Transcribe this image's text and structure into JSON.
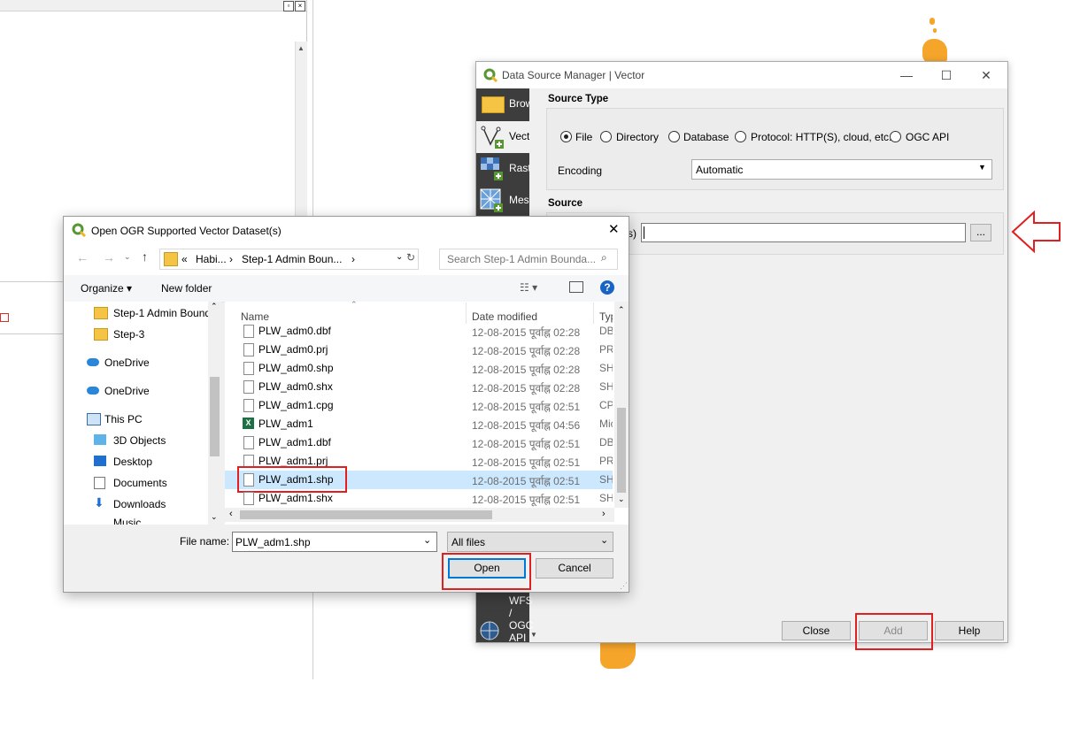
{
  "dsm": {
    "title": "Data Source Manager | Vector",
    "sidebar": [
      "Browser",
      "Vector",
      "Raster",
      "Mesh"
    ],
    "sidebar_bottom": [
      "WFS",
      "/",
      "OGC",
      "API"
    ],
    "source_type_label": "Source Type",
    "radio_options": [
      "File",
      "Directory",
      "Database",
      "Protocol: HTTP(S), cloud, etc.",
      "OGC API"
    ],
    "encoding_label": "Encoding",
    "encoding_value": "Automatic",
    "source_label": "Source",
    "source_field_label_fragment": "(s)",
    "browse_label": "...",
    "buttons": {
      "close": "Close",
      "add": "Add",
      "help": "Help"
    }
  },
  "dialog": {
    "title": "Open OGR Supported Vector Dataset(s)",
    "breadcrumb": [
      "«",
      "Habi...",
      "›",
      "Step-1 Admin Boun...",
      "›"
    ],
    "search_placeholder": "Search Step-1 Admin Bounda...",
    "organize": "Organize ▾",
    "new_folder": "New folder",
    "nav_items": [
      {
        "label": "Step-1 Admin Bound",
        "icon": "folder-icon"
      },
      {
        "label": "Step-3",
        "icon": "folder-icon"
      },
      {
        "label": "OneDrive",
        "icon": "onedrive-icon"
      },
      {
        "label": "OneDrive",
        "icon": "onedrive-icon"
      },
      {
        "label": "This PC",
        "icon": "pc-icon"
      },
      {
        "label": "3D Objects",
        "icon": "cube-icon"
      },
      {
        "label": "Desktop",
        "icon": "desktop-icon"
      },
      {
        "label": "Documents",
        "icon": "documents-icon"
      },
      {
        "label": "Downloads",
        "icon": "downloads-icon"
      },
      {
        "label": "Music",
        "icon": "music-icon"
      }
    ],
    "columns": {
      "name": "Name",
      "date": "Date modified",
      "type": "Type"
    },
    "files": [
      {
        "name": "PLW_adm0.dbf",
        "date": "12-08-2015 पूर्वाह्न 02:28",
        "type": "DBF"
      },
      {
        "name": "PLW_adm0.prj",
        "date": "12-08-2015 पूर्वाह्न 02:28",
        "type": "PRJ"
      },
      {
        "name": "PLW_adm0.shp",
        "date": "12-08-2015 पूर्वाह्न 02:28",
        "type": "SHP"
      },
      {
        "name": "PLW_adm0.shx",
        "date": "12-08-2015 पूर्वाह्न 02:28",
        "type": "SHX"
      },
      {
        "name": "PLW_adm1.cpg",
        "date": "12-08-2015 पूर्वाह्न 02:51",
        "type": "CPG"
      },
      {
        "name": "PLW_adm1",
        "date": "12-08-2015 पूर्वाह्न 04:56",
        "type": "Mic"
      },
      {
        "name": "PLW_adm1.dbf",
        "date": "12-08-2015 पूर्वाह्न 02:51",
        "type": "DBF"
      },
      {
        "name": "PLW_adm1.prj",
        "date": "12-08-2015 पूर्वाह्न 02:51",
        "type": "PRJ"
      },
      {
        "name": "PLW_adm1.shp",
        "date": "12-08-2015 पूर्वाह्न 02:51",
        "type": "SHP"
      },
      {
        "name": "PLW_adm1.shx",
        "date": "12-08-2015 पूर्वाह्न 02:51",
        "type": "SHX"
      }
    ],
    "selected_index": 8,
    "filename_label": "File name:",
    "filename_value": "PLW_adm1.shp",
    "filetype_value": "All files",
    "open_label": "Open",
    "cancel_label": "Cancel"
  },
  "colors": {
    "highlight": "#e02020",
    "selection": "#cce8ff",
    "map_fill": "#f5a52a",
    "sidebar": "#3d3d3d"
  }
}
